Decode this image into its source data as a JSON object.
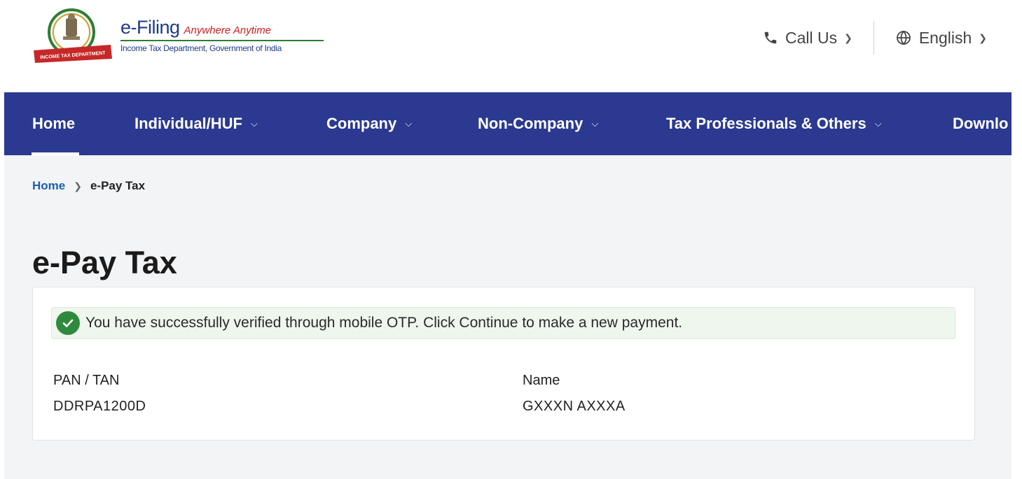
{
  "header": {
    "brand_title": "e-Filing",
    "brand_tagline": "Anywhere Anytime",
    "brand_subtitle": "Income Tax Department, Government of India",
    "emblem_ribbon_text": "INCOME TAX DEPARTMENT",
    "call_us_label": "Call Us",
    "language_label": "English"
  },
  "nav": {
    "items": [
      {
        "label": "Home"
      },
      {
        "label": "Individual/HUF"
      },
      {
        "label": "Company"
      },
      {
        "label": "Non-Company"
      },
      {
        "label": "Tax Professionals & Others"
      },
      {
        "label": "Downlo"
      }
    ]
  },
  "breadcrumb": {
    "home": "Home",
    "current": "e-Pay Tax"
  },
  "page": {
    "title": "e-Pay Tax"
  },
  "alert": {
    "message": "You have successfully verified through mobile OTP. Click Continue to make a new payment."
  },
  "details": {
    "pan_label": "PAN / TAN",
    "pan_value": "DDRPA1200D",
    "name_label": "Name",
    "name_value": "GXXXN AXXXA"
  },
  "colors": {
    "nav_bg": "#2b3990",
    "page_bg": "#f3f4f6",
    "success": "#2e8b3d",
    "alert_bg": "#eef6ee",
    "link": "#1a5fb4"
  }
}
